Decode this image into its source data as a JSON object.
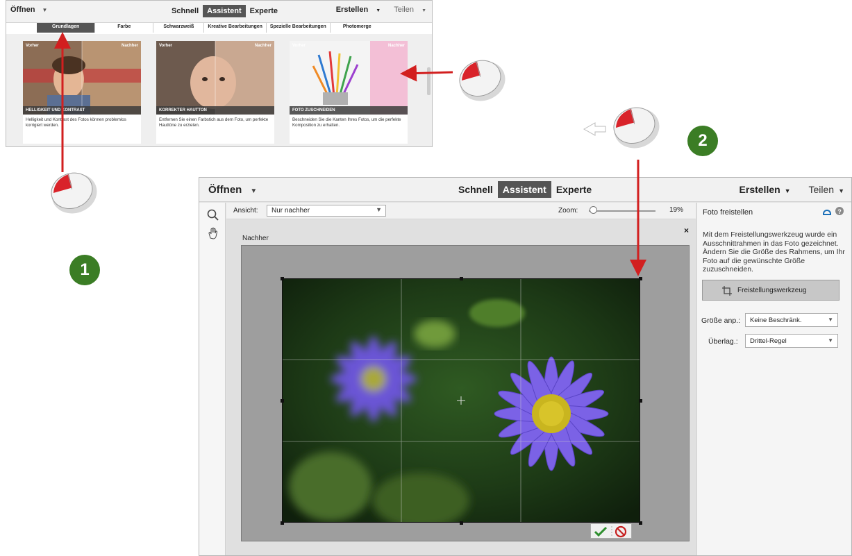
{
  "window1": {
    "open_label": "Öffnen",
    "modes": [
      "Schnell",
      "Assistent",
      "Experte"
    ],
    "create_label": "Erstellen",
    "share_label": "Teilen",
    "tabs": [
      "Grundlagen",
      "Farbe",
      "Schwarzweiß",
      "Kreative Bearbeitungen",
      "Spezielle Bearbeitungen",
      "Photomerge"
    ],
    "cards": [
      {
        "before": "Vorher",
        "after": "Nachher",
        "title": "HELLIGKEIT UND KONTRAST",
        "desc": "Helligkeit und Kontrast des Fotos können problemlos korrigiert werden."
      },
      {
        "before": "Vorher",
        "after": "Nachher",
        "title": "KORREKTER HAUTTON",
        "desc": "Entfernen Sie einen Farbstich aus dem Foto, um perfekte Hauttöne zu erzielen."
      },
      {
        "before": "Vorher",
        "after": "Nachher",
        "title": "FOTO ZUSCHNEIDEN",
        "desc": "Beschneiden Sie die Kanten Ihres Fotos, um die perfekte Komposition zu erhalten."
      }
    ]
  },
  "window2": {
    "open_label": "Öffnen",
    "modes": [
      "Schnell",
      "Assistent",
      "Experte"
    ],
    "create_label": "Erstellen",
    "share_label": "Teilen",
    "view_label": "Ansicht:",
    "view_value": "Nur nachher",
    "zoom_label": "Zoom:",
    "zoom_value": "19%",
    "zoom_level": 0.19,
    "canvas_label": "Nachher",
    "close_glyph": "×",
    "panel": {
      "title": "Foto freistellen",
      "description": "Mit dem Freistellungswerkzeug wurde ein Ausschnittrahmen in das Foto gezeichnet. Ändern Sie die Größe des Rahmens, um Ihr Foto auf die gewünschte Größe zuzuschneiden.",
      "tool_button": "Freistellungswerkzeug",
      "size_label": "Größe anp.:",
      "size_value": "Keine Beschränk.",
      "overlay_label": "Überlag.:",
      "overlay_value": "Drittel-Regel"
    }
  },
  "callouts": {
    "step1": "1",
    "step2": "2"
  },
  "colors": {
    "accent": "#555555",
    "badge": "#3b7d25",
    "arrow": "#d21f1f"
  }
}
